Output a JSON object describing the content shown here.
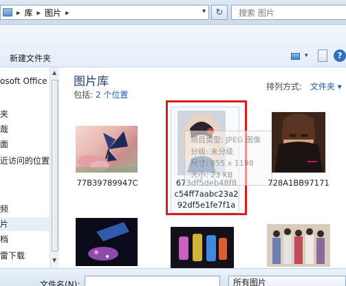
{
  "address": {
    "crumbs": [
      "库",
      "图片"
    ],
    "separator": "▸",
    "dropdown_glyph": "▾"
  },
  "refresh_glyph": "↻",
  "search": {
    "placeholder": "搜索 图片"
  },
  "toolbar": {
    "new_folder": "新建文件夹",
    "help": "?"
  },
  "nav": {
    "items": [
      {
        "label": "osoft Office",
        "selected": false
      },
      {
        "label": "夹",
        "selected": false
      },
      {
        "label": "哉",
        "selected": false
      },
      {
        "label": "面",
        "selected": false
      },
      {
        "label": "近访问的位置",
        "selected": false
      },
      {
        "label": "频",
        "selected": false
      },
      {
        "label": "片",
        "selected": true
      },
      {
        "label": "档",
        "selected": false
      },
      {
        "label": "雷下载",
        "selected": false
      }
    ]
  },
  "library": {
    "title": "图片库",
    "includes_label": "包括:",
    "includes_link": "2 个位置",
    "arrange_label": "排列方式:",
    "arrange_value": "文件夹 ▾"
  },
  "files": [
    {
      "caption": "77B39789947C"
    },
    {
      "caption_lines": [
        "673df5deb48f8",
        "c54ff7aabc23a2",
        "92df5e1fe7f1a"
      ]
    },
    {
      "caption": "728A1BB97171"
    }
  ],
  "tooltip": {
    "lines": [
      "项目类型: JPEG 图像",
      "分级: 未分级",
      "尺寸: 855 x 1198",
      "大小: 23 KB"
    ]
  },
  "bottom": {
    "filename_label": "文件名(N):",
    "filetype_value": "所有图片"
  }
}
